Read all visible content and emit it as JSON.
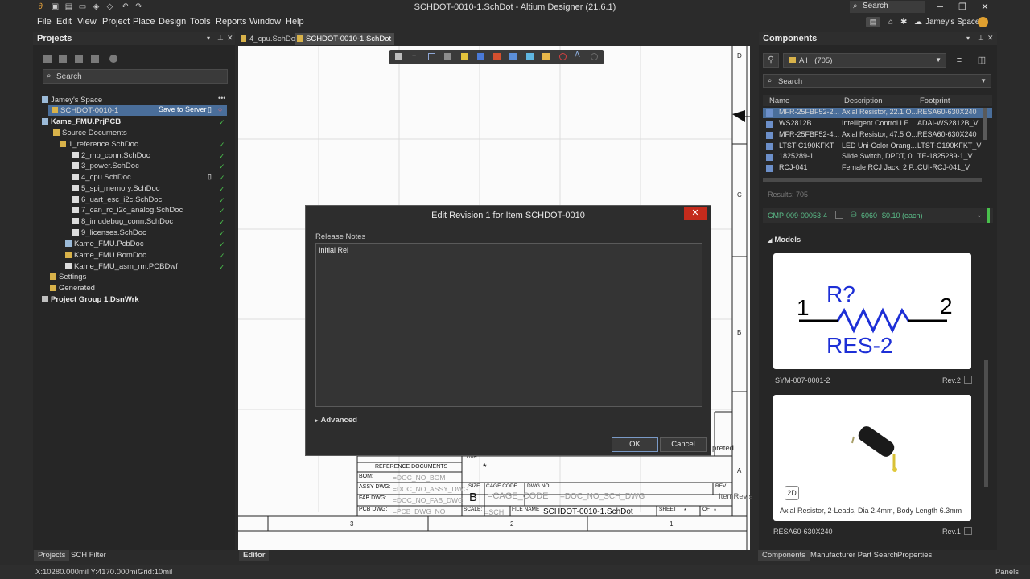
{
  "window": {
    "title": "SCHDOT-0010-1.SchDot - Altium Designer (21.6.1)",
    "search_placeholder": "Search",
    "user_space": "Jamey's Space"
  },
  "menu": [
    "File",
    "Edit",
    "View",
    "Project",
    "Place",
    "Design",
    "Tools",
    "Reports",
    "Window",
    "Help"
  ],
  "projects_panel": {
    "title": "Projects",
    "search_placeholder": "Search",
    "tree": [
      {
        "label": "Jamey's Space",
        "icon": "cloud-icon",
        "check": false
      },
      {
        "label": "SCHDOT-0010-1",
        "extra": "Save to Server",
        "icon": "doc-icon",
        "check": false
      },
      {
        "label": "Kame_FMU.PrjPCB",
        "icon": "project-icon",
        "check": true
      },
      {
        "label": "Source Documents",
        "icon": "folder-icon",
        "check": false
      },
      {
        "label": "1_reference.SchDoc",
        "icon": "folder-icon",
        "check": true
      },
      {
        "label": "2_mb_conn.SchDoc",
        "icon": "schdoc-icon",
        "check": true
      },
      {
        "label": "3_power.SchDoc",
        "icon": "schdoc-icon",
        "check": true
      },
      {
        "label": "4_cpu.SchDoc",
        "icon": "schdoc-icon",
        "check": true
      },
      {
        "label": "5_spi_memory.SchDoc",
        "icon": "schdoc-icon",
        "check": true
      },
      {
        "label": "6_uart_esc_i2c.SchDoc",
        "icon": "schdoc-icon",
        "check": true
      },
      {
        "label": "7_can_rc_i2c_analog.SchDoc",
        "icon": "schdoc-icon",
        "check": true
      },
      {
        "label": "8_imudebug_conn.SchDoc",
        "icon": "schdoc-icon",
        "check": true
      },
      {
        "label": "9_licenses.SchDoc",
        "icon": "schdoc-icon",
        "check": true
      },
      {
        "label": "Kame_FMU.PcbDoc",
        "icon": "pcbdoc-icon",
        "check": true
      },
      {
        "label": "Kame_FMU.BomDoc",
        "icon": "bomdoc-icon",
        "check": true
      },
      {
        "label": "Kame_FMU_asm_rm.PCBDwf",
        "icon": "pcbdwf-icon",
        "check": true
      },
      {
        "label": "Settings",
        "icon": "folder-icon",
        "check": false
      },
      {
        "label": "Generated",
        "icon": "folder-icon",
        "check": false
      },
      {
        "label": "Project Group 1.DsnWrk",
        "icon": "group-icon",
        "check": false
      }
    ]
  },
  "doc_tabs": [
    {
      "label": "4_cpu.SchDoc",
      "active": false
    },
    {
      "label": "SCHDOT-0010-1.SchDot",
      "active": true
    }
  ],
  "schematic": {
    "zone_letters": [
      "D",
      "C",
      "B",
      "A"
    ],
    "zone_numbers": [
      "3",
      "2",
      "1"
    ],
    "title_block": {
      "title_label": "Title",
      "title_value": "*",
      "ref_docs": "REFERENCE DOCUMENTS",
      "bom_label": "BOM:",
      "bom_value": "=DOC_NO_BOM",
      "assy_label": "ASSY DWG:",
      "assy_value": "=DOC_NO_ASSY_DWG",
      "fab_label": "FAB DWG:",
      "fab_value": "=DOC_NO_FAB_DWG",
      "pcb_label": "PCB DWG:",
      "pcb_value": "=PCB_DWG_NO",
      "size_label": "SIZE",
      "size_value": "B",
      "cage_label": "CAGE CODE",
      "cage_value": "=CAGE_CODE",
      "dwg_label": "DWG NO.",
      "dwg_value": "=DOC_NO_SCH_DWG",
      "rev_label": "REV",
      "rev_value": "ItemRevis",
      "scale_label": "SCALE:",
      "scale_value": "=SCH",
      "file_label": "FILE NAME",
      "file_value": "SCHDOT-0010-1.SchDot",
      "sheet_label": "SHEET",
      "sheet_value": "*",
      "of_label": "OF",
      "of_value": "*",
      "side_text": "preted"
    }
  },
  "dialog": {
    "title": "Edit Revision 1 for Item SCHDOT-0010",
    "close": "✕",
    "release_label": "Release Notes",
    "release_value": "Initial Rel",
    "advanced": "Advanced",
    "ok": "OK",
    "cancel": "Cancel"
  },
  "components_panel": {
    "title": "Components",
    "filter_value": "All",
    "filter_count": "(705)",
    "search_placeholder": "Search",
    "columns": [
      "Name",
      "Description",
      "Footprint"
    ],
    "rows": [
      [
        "MFR-25FBF52-2...",
        "Axial Resistor, 22.1 O...",
        "RESA60-630X240"
      ],
      [
        "WS2812B",
        "Intelligent Control LE...",
        "ADAI-WS2812B_V"
      ],
      [
        "MFR-25FBF52-4...",
        "Axial Resistor, 47.5 O...",
        "RESA60-630X240"
      ],
      [
        "LTST-C190KFKT",
        "LED Uni-Color Orang...",
        "LTST-C190KFKT_V"
      ],
      [
        "1825289-1",
        "Slide Switch, DPDT, 0....",
        "TE-1825289-1_V"
      ],
      [
        "RCJ-041",
        "Female RCJ Jack, 2 P...",
        "CUI-RCJ-041_V"
      ]
    ],
    "results": "Results: 705",
    "part_id": "CMP-009-00053-4",
    "stock": "6060",
    "price": "$0.10 (each)",
    "models_label": "Models",
    "symbol": {
      "pin1": "1",
      "pin2": "2",
      "designator": "R?",
      "value": "RES-2",
      "name": "SYM-007-0001-2",
      "rev": "Rev.2"
    },
    "footprint": {
      "badge": "2D",
      "description": "Axial Resistor, 2-Leads, Dia 2.4mm, Body Length 6.3mm",
      "name": "RESA60-630X240",
      "rev": "Rev.1"
    }
  },
  "bottom_tabs": {
    "left": [
      "Projects",
      "SCH Filter"
    ],
    "center": "Editor",
    "right": [
      "Components",
      "Manufacturer Part Search",
      "Properties"
    ]
  },
  "status": {
    "coords": "X:10280.000mil Y:4170.000mil",
    "grid": "Grid:10mil",
    "panels": "Panels"
  },
  "colors": {
    "accent": "#4a6e9a",
    "close_red": "#c42b1c",
    "ok_green": "#49c04c",
    "schematic_bg": "#fbfbfb",
    "schematic_blue": "#1d2fd6"
  }
}
